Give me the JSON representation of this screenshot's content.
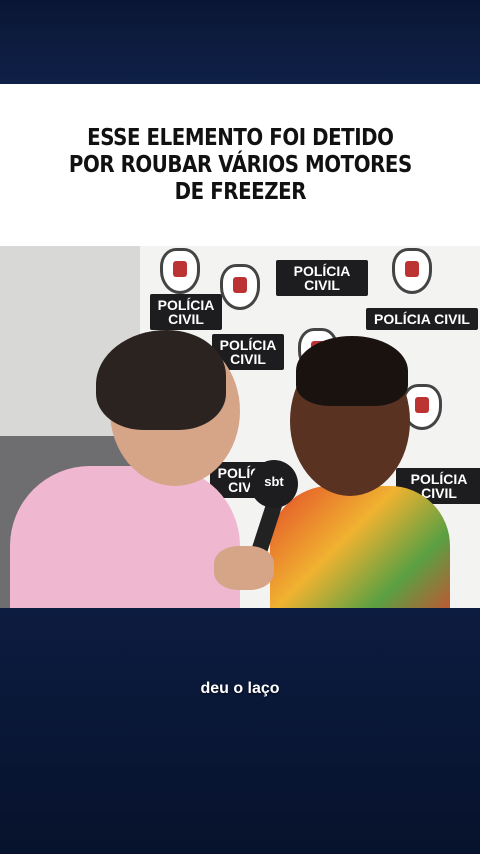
{
  "headline": {
    "text": "ESSE ELEMENTO FOI DETIDO\nPOR ROUBAR VÁRIOS MOTORES\nDE FREEZER"
  },
  "video": {
    "backdrop_label": "POLÍCIA CIVIL",
    "mic_logo": "sbt"
  },
  "subtitle": {
    "text": "deu o laço"
  },
  "colors": {
    "background": "#0b1a3a",
    "card": "#ffffff",
    "headline_text": "#111111"
  }
}
